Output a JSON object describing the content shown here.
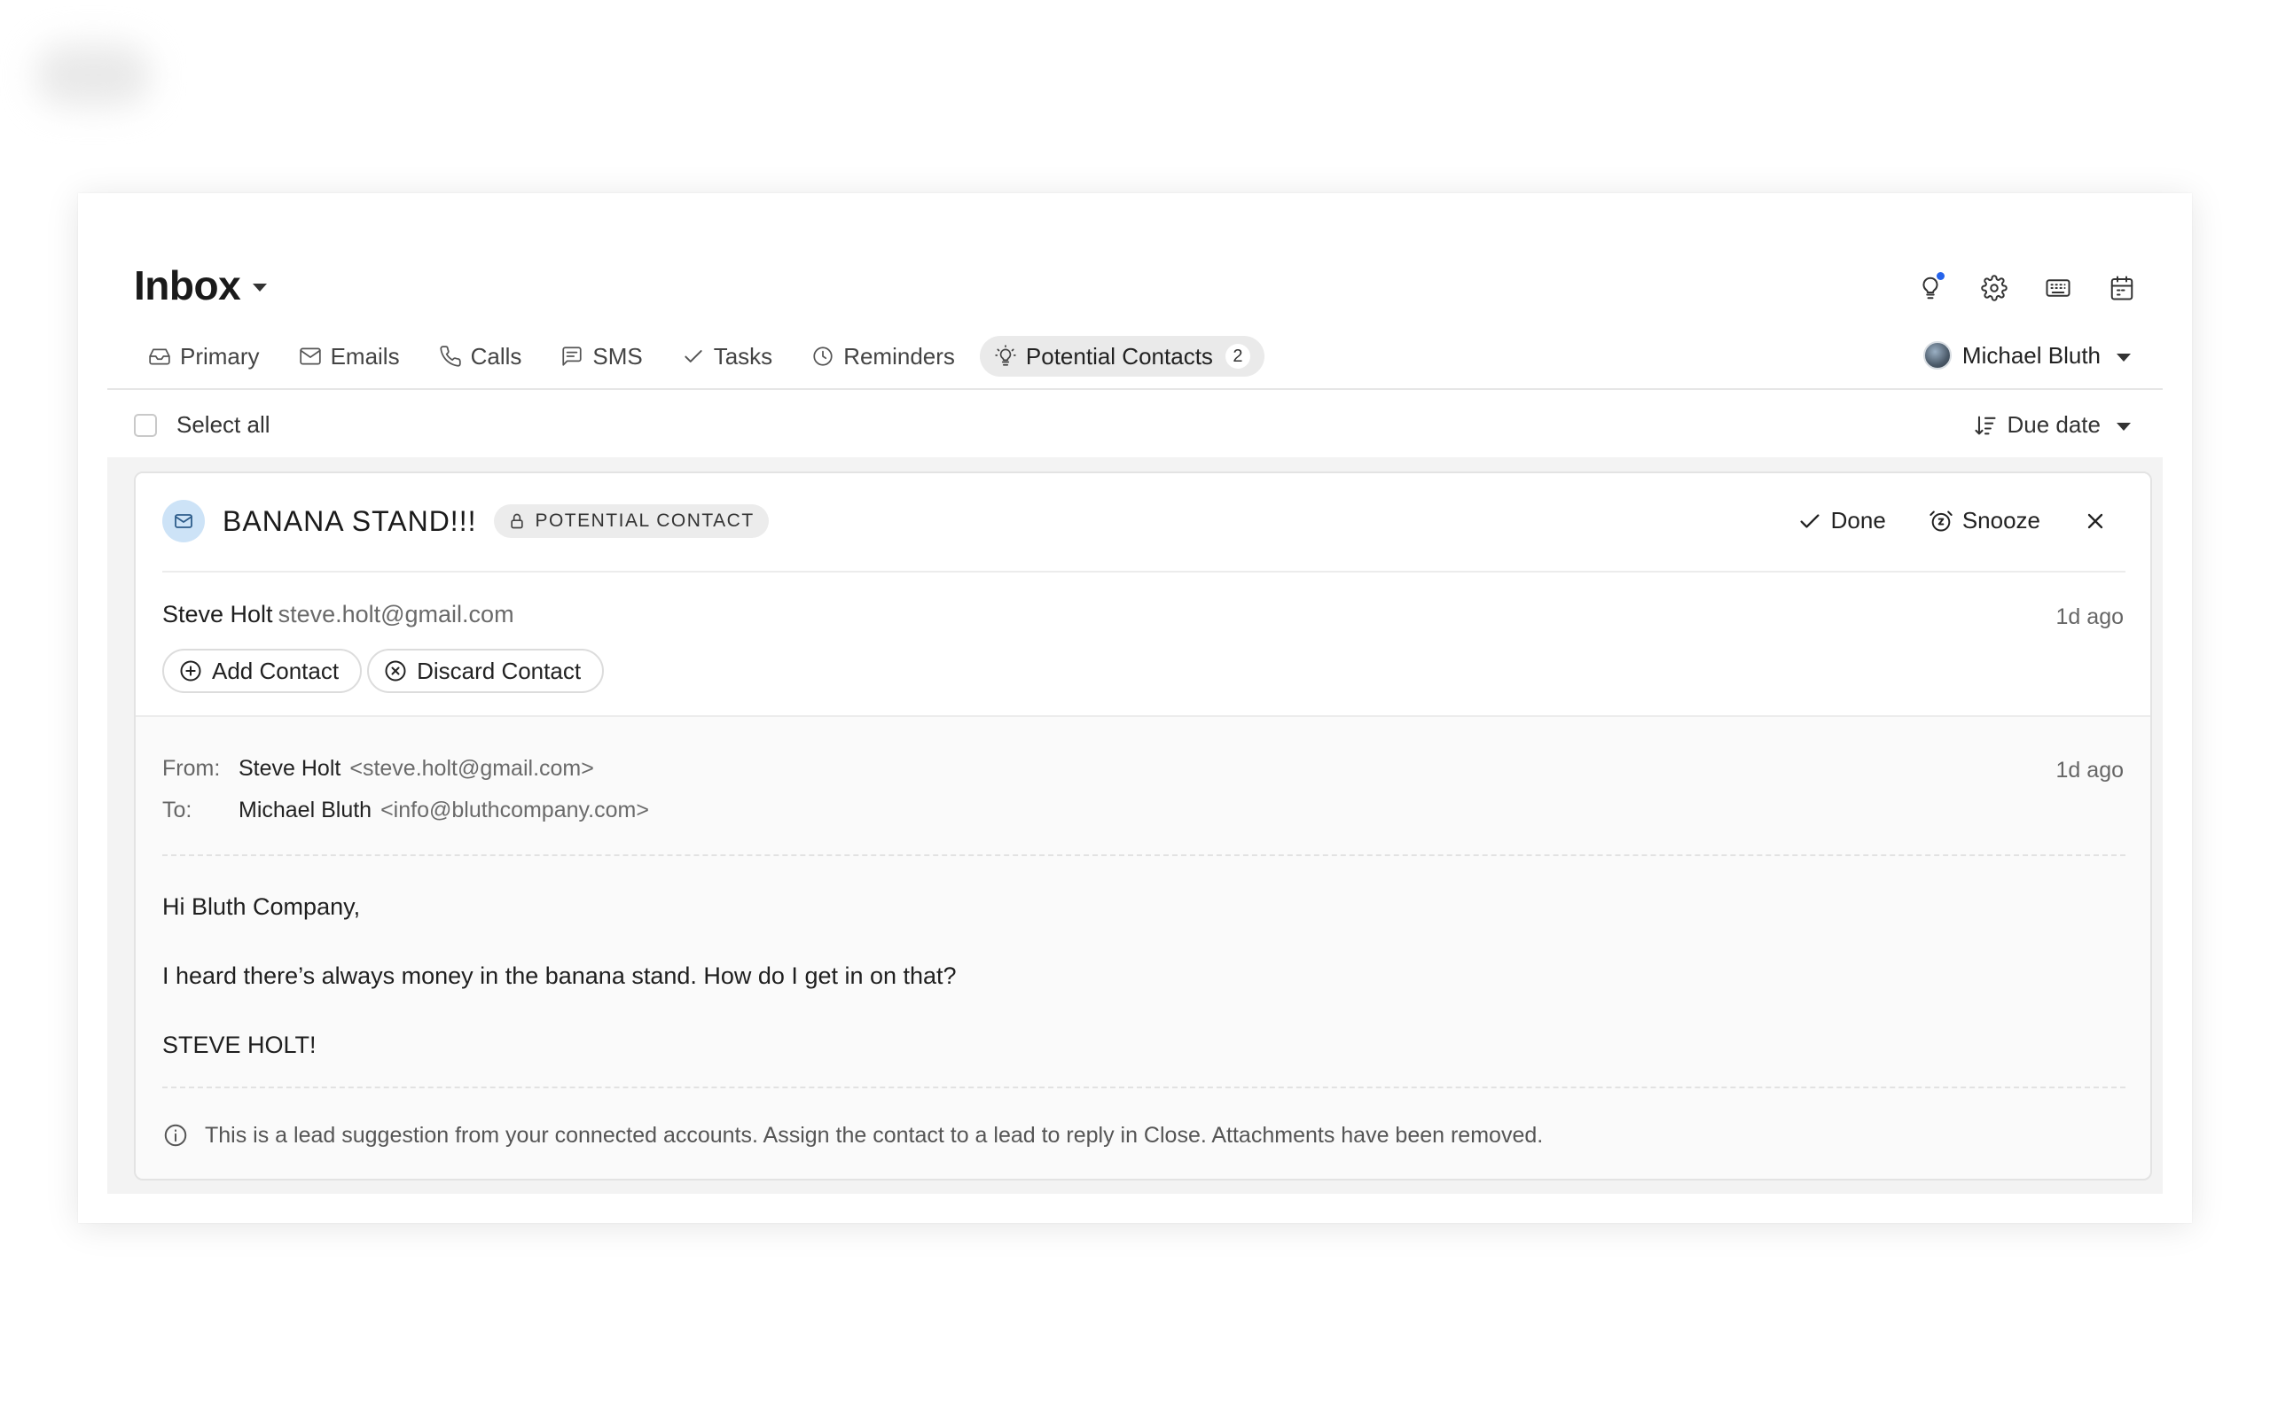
{
  "header": {
    "title": "Inbox",
    "icons": [
      "lightbulb-icon",
      "gear-icon",
      "keyboard-icon",
      "calendar-icon"
    ],
    "notification_color": "#2563eb"
  },
  "tabs": [
    {
      "label": "Primary",
      "icon": "inbox-tray-icon"
    },
    {
      "label": "Emails",
      "icon": "envelope-icon"
    },
    {
      "label": "Calls",
      "icon": "phone-icon"
    },
    {
      "label": "SMS",
      "icon": "chat-icon"
    },
    {
      "label": "Tasks",
      "icon": "check-icon"
    },
    {
      "label": "Reminders",
      "icon": "clock-icon"
    },
    {
      "label": "Potential Contacts",
      "icon": "lightbulb-icon",
      "count": "2",
      "active": true
    }
  ],
  "user": {
    "name": "Michael Bluth"
  },
  "toolbar": {
    "select_all": "Select all",
    "sort_label": "Due date"
  },
  "card": {
    "subject": "BANANA STAND!!!",
    "tag": "POTENTIAL CONTACT",
    "actions": {
      "done": "Done",
      "snooze": "Snooze"
    },
    "sender_name": "Steve Holt",
    "sender_email": "steve.holt@gmail.com",
    "time": "1d ago",
    "add_contact": "Add Contact",
    "discard_contact": "Discard Contact",
    "email": {
      "from_label": "From:",
      "from_name": "Steve Holt",
      "from_email": "<steve.holt@gmail.com>",
      "to_label": "To:",
      "to_name": "Michael Bluth",
      "to_email": "<info@bluthcompany.com>",
      "time": "1d ago",
      "body": [
        "Hi Bluth Company,",
        "I heard there’s always money in the banana stand. How do I get in on that?",
        "STEVE HOLT!"
      ],
      "footnote": "This is a lead suggestion from your connected accounts. Assign the contact to a lead to reply in Close. Attachments have been removed."
    }
  }
}
